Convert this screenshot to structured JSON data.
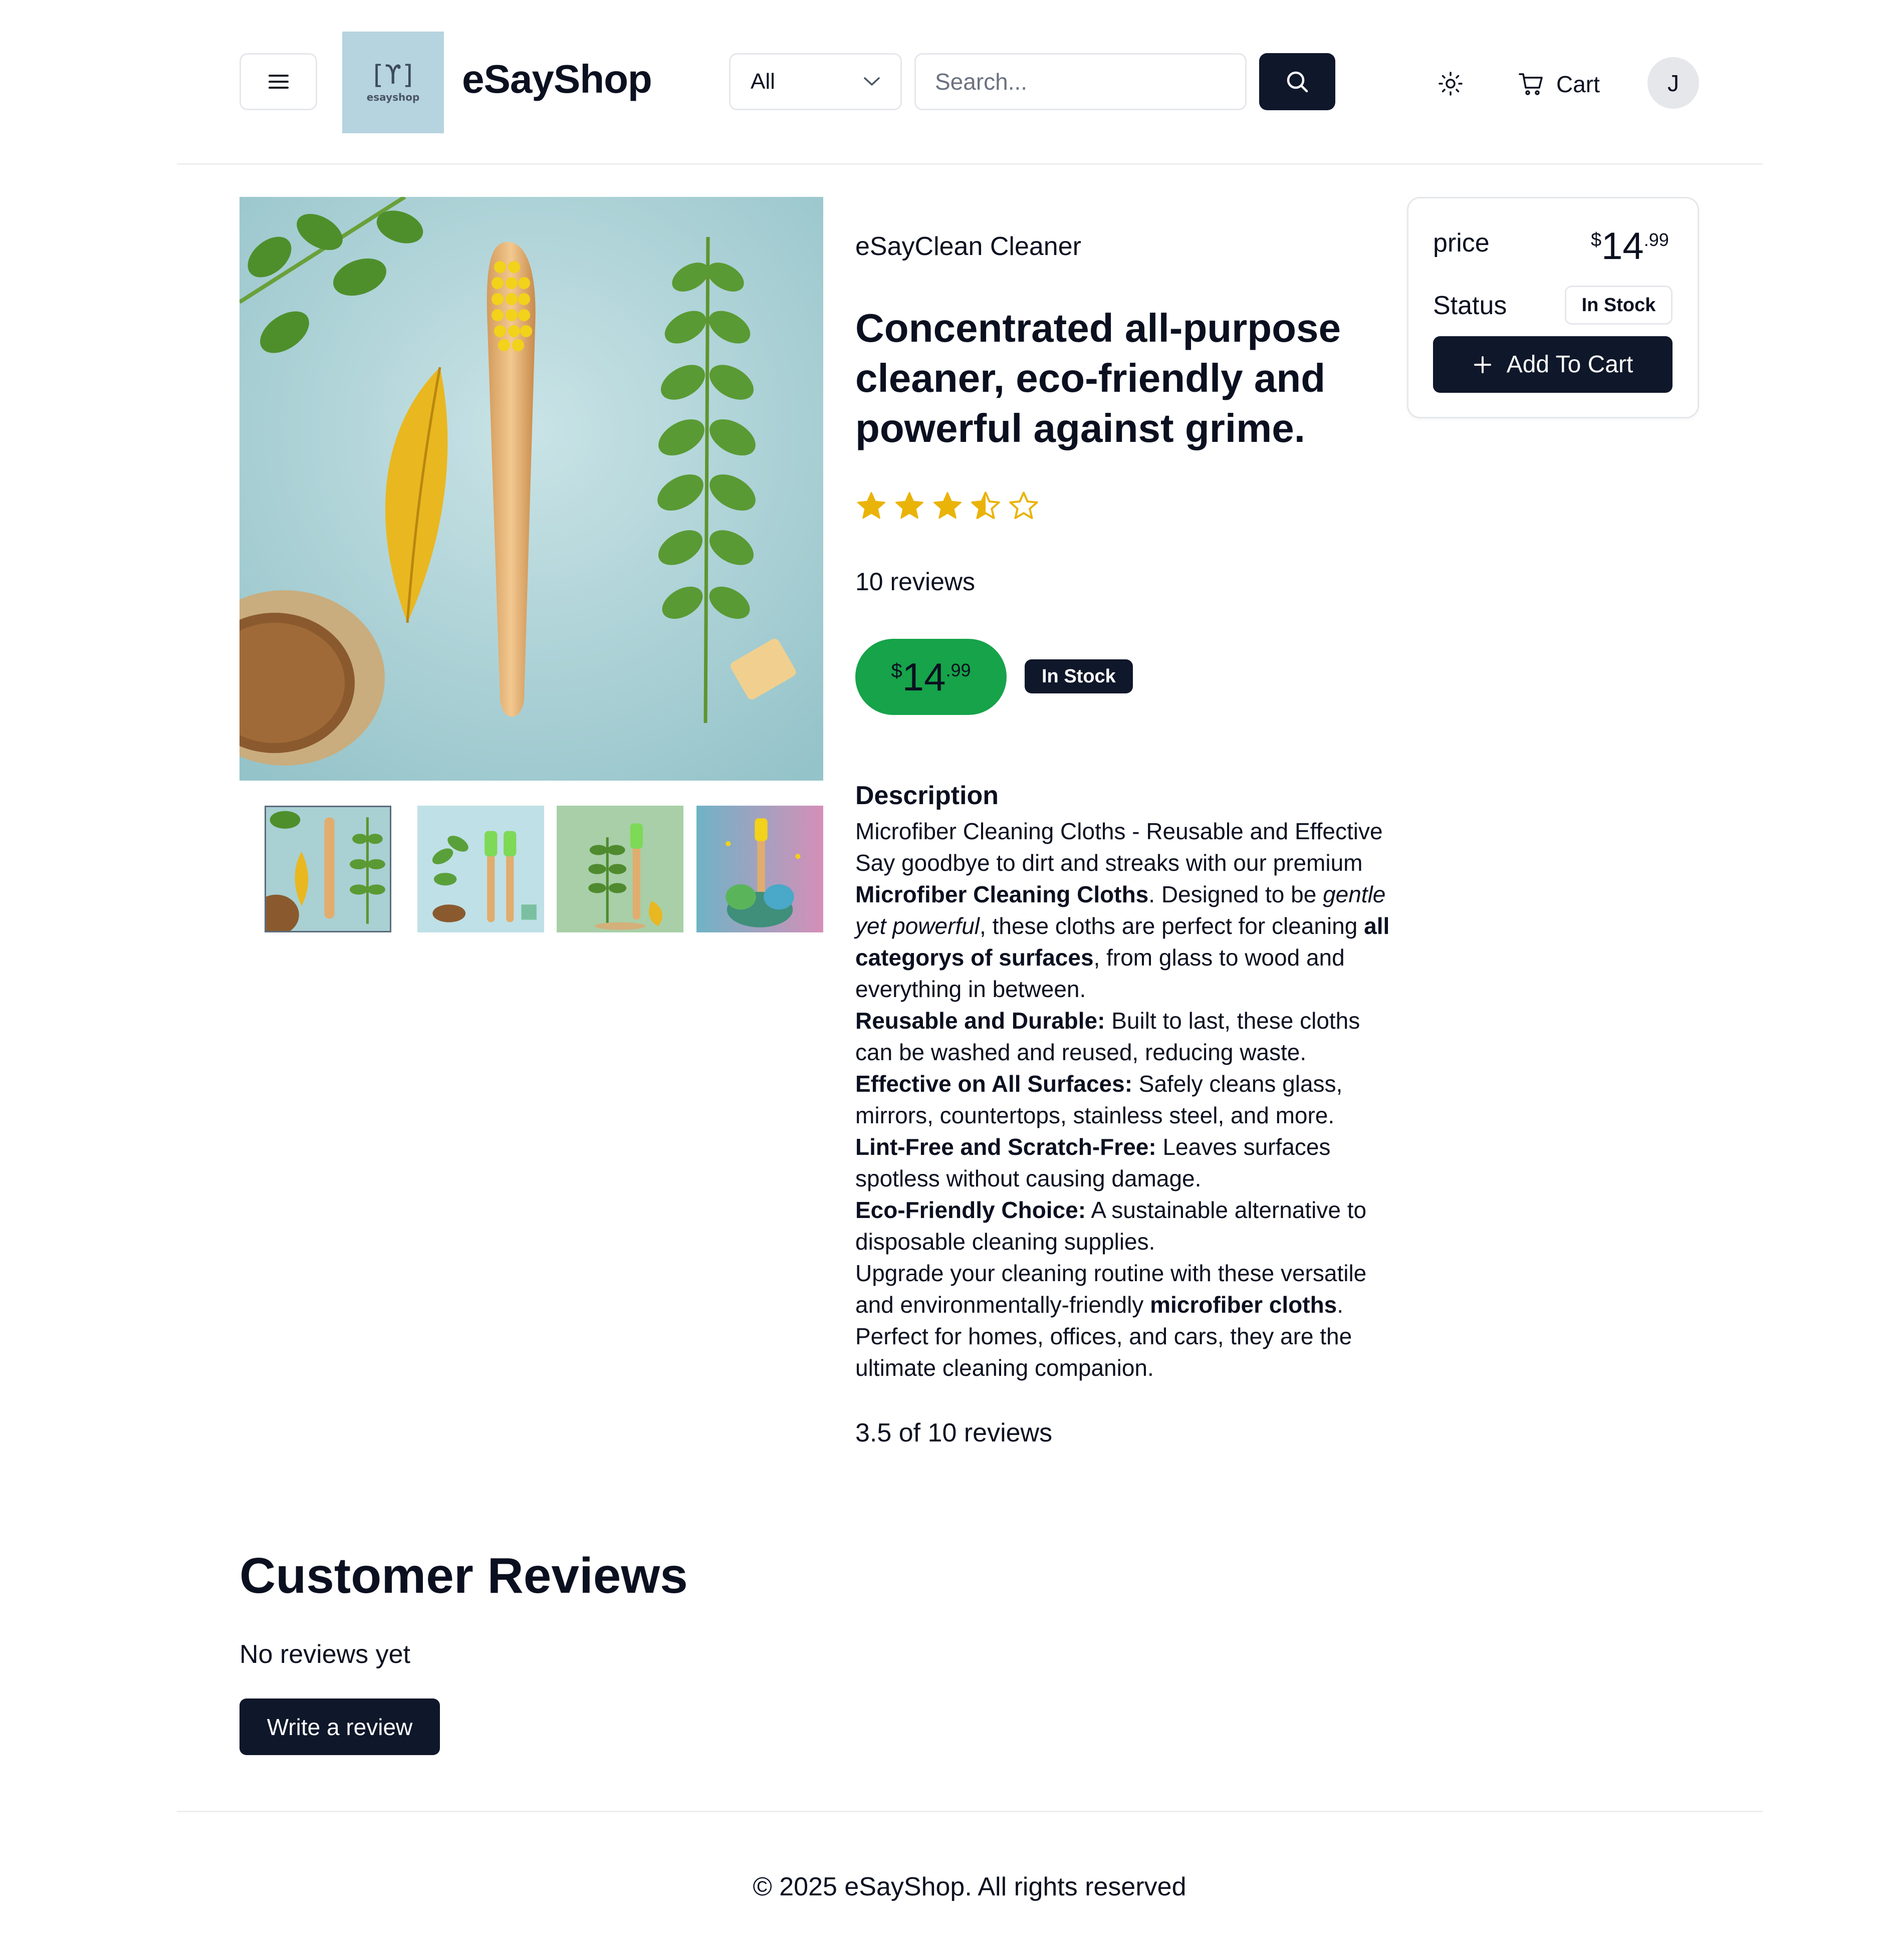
{
  "header": {
    "logo_mark": "[ϒ]",
    "logo_word": "esayshop",
    "brand": "eSayShop",
    "category_selected": "All",
    "search_placeholder": "Search...",
    "cart_label": "Cart",
    "avatar_initial": "J"
  },
  "product": {
    "brand": "eSayClean Cleaner",
    "title": "Concentrated all-purpose cleaner, eco-friendly and powerful against grime.",
    "rating": 3.5,
    "rating_max": 5,
    "reviews_count": "10 reviews",
    "price": {
      "currency": "$",
      "integer": "14",
      "decimal": ".99"
    },
    "stock_label": "In Stock",
    "description_heading": "Description",
    "description": {
      "p1": "Microfiber Cleaning Cloths - Reusable and Effective",
      "p2_a": "Say goodbye to dirt and streaks with our premium ",
      "p2_b": "Microfiber Cleaning Cloths",
      "p2_c": ". Designed to be ",
      "p2_d": "gentle yet powerful",
      "p2_e": ", these cloths are perfect for cleaning ",
      "p2_f": "all categorys of surfaces",
      "p2_g": ", from glass to wood and everything in between.",
      "f1_label": "Reusable and Durable:",
      "f1_text": " Built to last, these cloths can be washed and reused, reducing waste.",
      "f2_label": "Effective on All Surfaces:",
      "f2_text": " Safely cleans glass, mirrors, countertops, stainless steel, and more.",
      "f3_label": "Lint-Free and Scratch-Free:",
      "f3_text": " Leaves surfaces spotless without causing damage.",
      "f4_label": "Eco-Friendly Choice:",
      "f4_text": " A sustainable alternative to disposable cleaning supplies.",
      "p3_a": "Upgrade your cleaning routine with these versatile and environmentally-friendly ",
      "p3_b": "microfiber cloths",
      "p3_c": ". Perfect for homes, offices, and cars, they are the ultimate cleaning companion."
    },
    "rating_text": "3.5 of 10 reviews"
  },
  "sidebar": {
    "price_label": "price",
    "status_label": "Status",
    "stock_label": "In Stock",
    "add_to_cart": "Add To Cart"
  },
  "reviews": {
    "heading": "Customer Reviews",
    "empty": "No reviews yet",
    "write_button": "Write a review"
  },
  "footer": {
    "copyright": "© 2025 eSayShop. All rights reserved"
  },
  "colors": {
    "primary": "#0f172a",
    "price_pill": "#16a34a",
    "star": "#eab308",
    "logo_bg": "#b6d3e0"
  },
  "icons": [
    "menu-icon",
    "chevron-down-icon",
    "search-icon",
    "sun-icon",
    "cart-icon",
    "plus-icon",
    "star-icon"
  ]
}
